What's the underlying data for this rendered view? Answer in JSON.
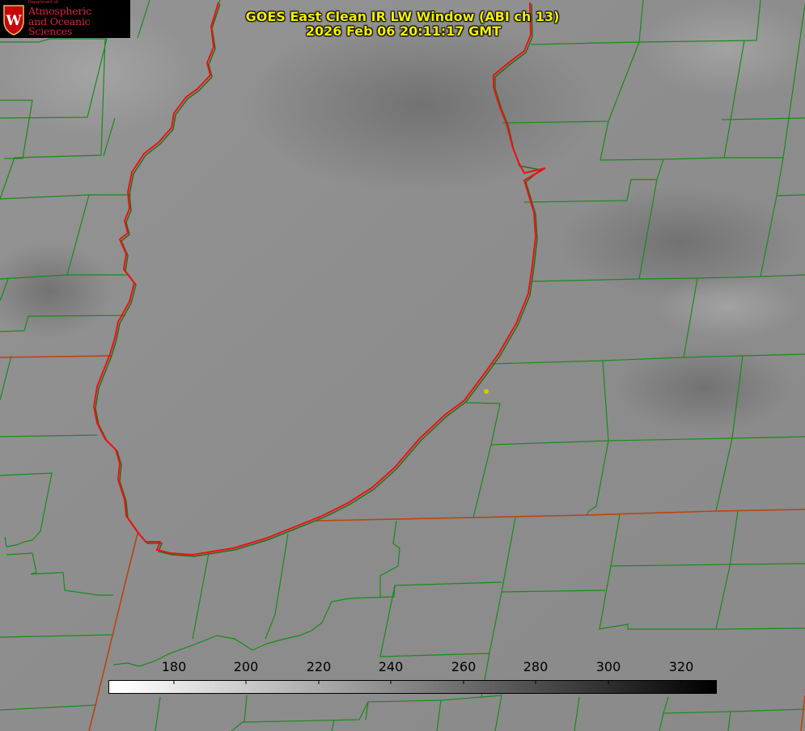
{
  "header": {
    "title_line1": "GOES East Clean IR LW Window (ABI ch 13)",
    "title_line2": "2026 Feb 06 20:11:17 GMT"
  },
  "logo": {
    "department": "Department of",
    "line1": "Atmospheric",
    "line2": "and Oceanic Sciences",
    "badge_letter": "W",
    "accent_color": "#d8243c"
  },
  "colorbar": {
    "ticks": [
      "180",
      "200",
      "220",
      "240",
      "260",
      "280",
      "300",
      "320"
    ],
    "gradient_from": "#ffffff",
    "gradient_to": "#000000"
  },
  "map": {
    "lake_outline_color": "#ee1111",
    "county_line_color": "#1a8a1a",
    "state_line_color": "#b84510",
    "marker_color": "#d8c800"
  }
}
